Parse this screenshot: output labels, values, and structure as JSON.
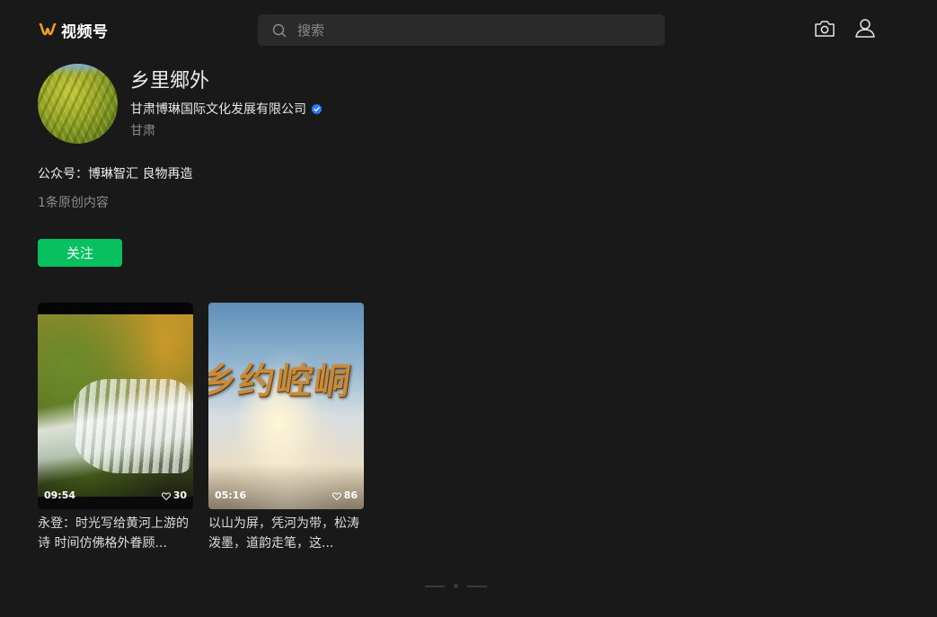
{
  "header": {
    "logo_text": "视频号",
    "logo_color": "#f0a020",
    "search_placeholder": "搜索",
    "camera_icon": "camera-icon",
    "user_icon": "user-icon"
  },
  "profile": {
    "name": "乡里郷外",
    "company": "甘肃博琳国际文化发展有限公司",
    "verified_color": "#2b7cff",
    "location": "甘肃",
    "public_account": "公众号：博琳智汇 良物再造",
    "original_count": "1条原创内容",
    "follow_label": "关注",
    "follow_color": "#07c160"
  },
  "videos": [
    {
      "duration": "09:54",
      "likes": "30",
      "title": "永登：时光写给黄河上游的诗 时间仿佛格外眷顾..."
    },
    {
      "duration": "05:16",
      "likes": "86",
      "title": "以山为屏，凭河为带，松涛泼墨，道韵走笔，这..."
    }
  ],
  "thumbnail_text": {
    "video_2_overlay": "乡约崆峒"
  }
}
